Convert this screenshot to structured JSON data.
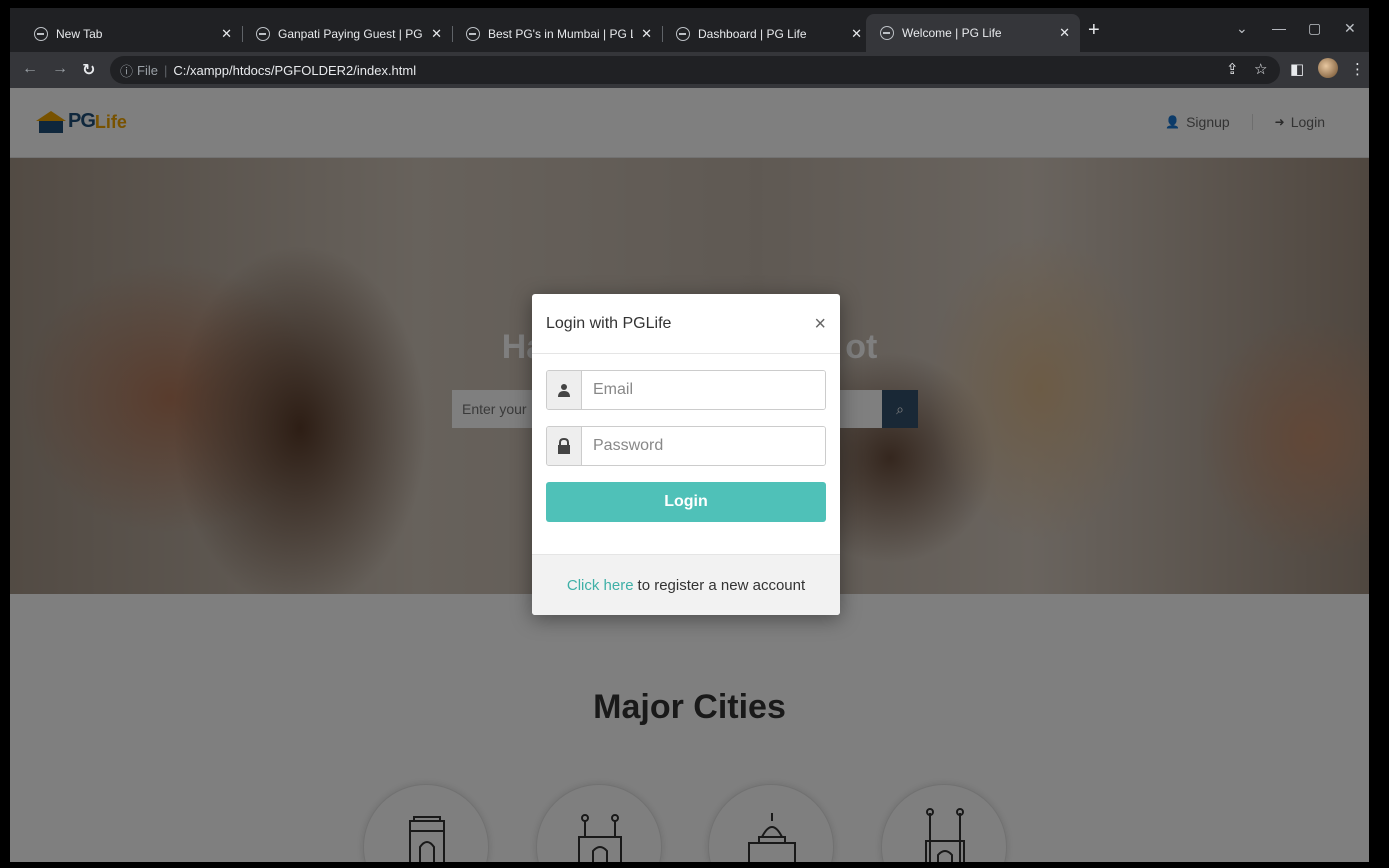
{
  "browser": {
    "tabs": [
      {
        "title": "New Tab",
        "active": false
      },
      {
        "title": "Ganpati Paying Guest | PG Life",
        "active": false
      },
      {
        "title": "Best PG's in Mumbai | PG Life",
        "active": false
      },
      {
        "title": "Dashboard | PG Life",
        "active": false
      },
      {
        "title": "Welcome | PG Life",
        "active": true
      }
    ],
    "address": {
      "scheme": "File",
      "url": "C:/xampp/htdocs/PGFOLDER2/index.html"
    }
  },
  "site": {
    "logo": {
      "pg": "PG",
      "life": "Life"
    },
    "nav": {
      "signup": "Signup",
      "login": "Login"
    },
    "banner": {
      "title_left": "Ha",
      "title_right": "ot",
      "search_placeholder": "Enter your"
    },
    "major_cities_heading": "Major Cities"
  },
  "modal": {
    "title": "Login with PGLife",
    "close": "×",
    "email_placeholder": "Email",
    "password_placeholder": "Password",
    "login_button": "Login",
    "footer_link": "Click here",
    "footer_text": "to register a new account"
  },
  "colors": {
    "accent": "#4fc1b8",
    "link": "#3fb0a7",
    "brand_blue": "#1e4e79",
    "brand_orange": "#f0a500"
  }
}
